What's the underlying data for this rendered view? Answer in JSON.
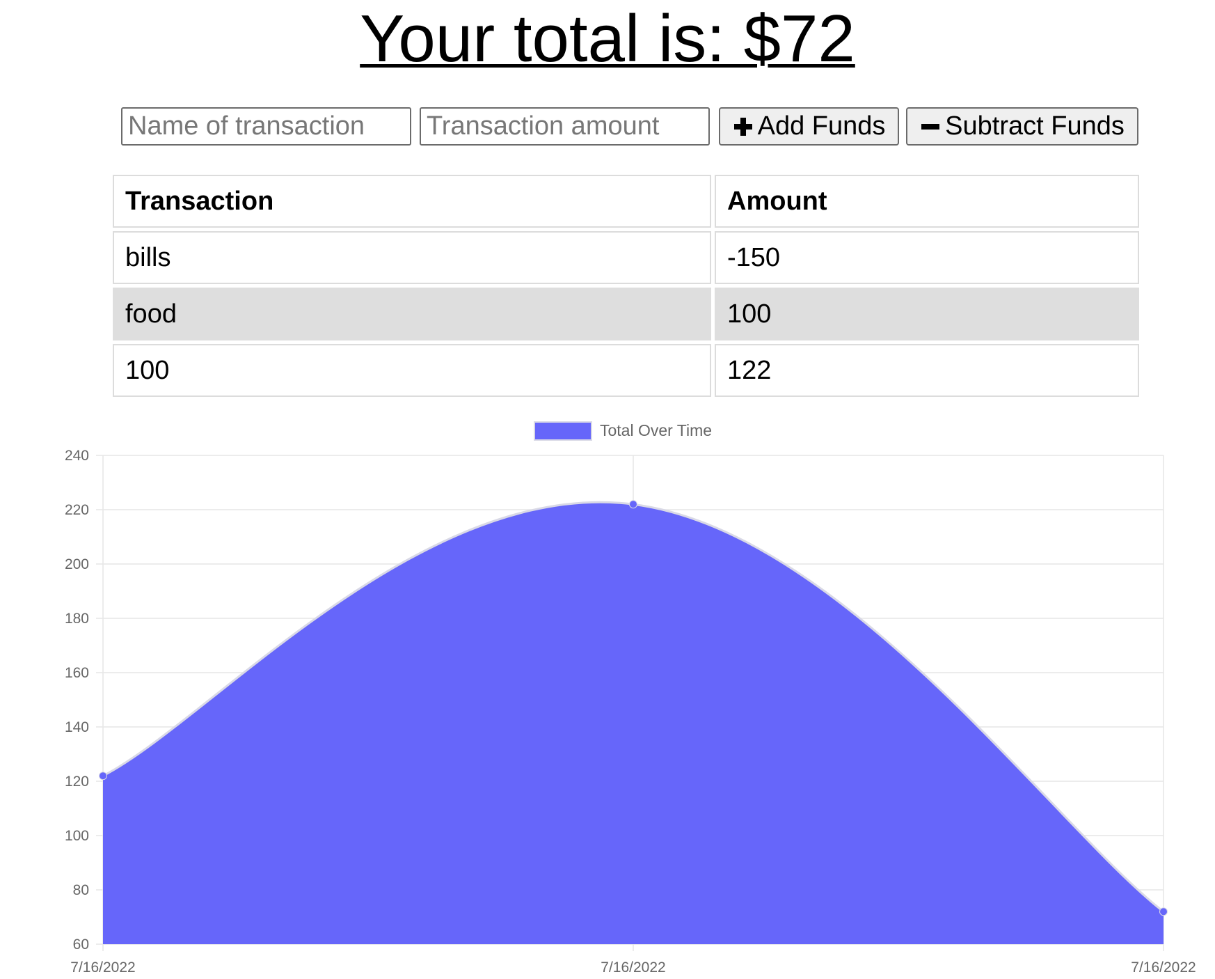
{
  "header": {
    "total_text": "Your total is: $72"
  },
  "form": {
    "name_placeholder": "Name of transaction",
    "amount_placeholder": "Transaction amount",
    "add_label": "Add Funds",
    "subtract_label": "Subtract Funds"
  },
  "table": {
    "headers": [
      "Transaction",
      "Amount"
    ],
    "rows": [
      {
        "name": "bills",
        "amount": "-150"
      },
      {
        "name": "food",
        "amount": "100"
      },
      {
        "name": "100",
        "amount": "122"
      }
    ]
  },
  "colors": {
    "fill": "#6666fa",
    "line": "#d9d9e6",
    "point": "#6666fa",
    "grid": "#e6e6e6",
    "shaded_row": "#dedede"
  },
  "chart_data": {
    "type": "area",
    "x": [
      "7/16/2022",
      "7/16/2022",
      "7/16/2022"
    ],
    "series": [
      {
        "name": "Total Over Time",
        "values": [
          122,
          222,
          72
        ]
      }
    ],
    "ylim": [
      60,
      240
    ],
    "yticks": [
      240,
      220,
      200,
      180,
      160,
      140,
      120,
      100,
      80,
      60
    ],
    "grid": true,
    "legend": "top-center",
    "curve": "smooth"
  }
}
